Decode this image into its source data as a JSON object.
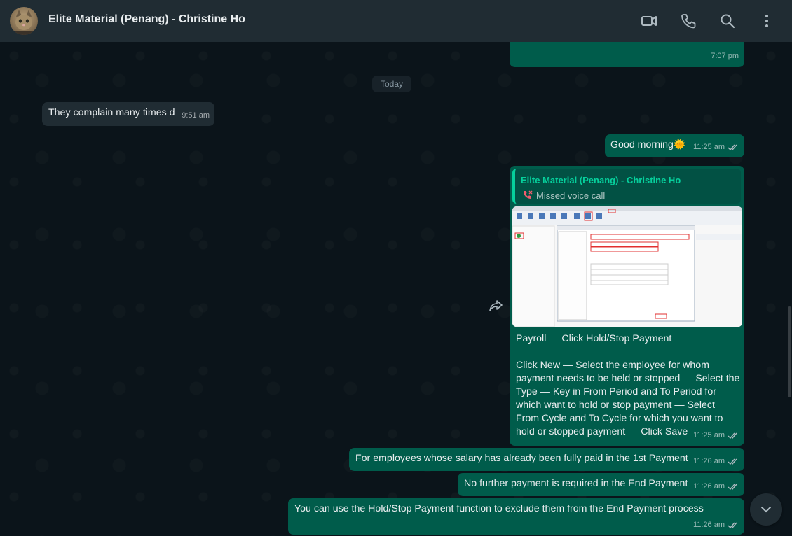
{
  "header": {
    "title": "Elite Material (Penang) - Christine Ho",
    "icons": [
      "video-call-icon",
      "voice-call-icon",
      "search-icon",
      "menu-icon"
    ]
  },
  "day_separator": "Today",
  "messages": {
    "prev_time": "7:07 pm",
    "m1": {
      "text": "They complain many times d",
      "time": "9:51 am"
    },
    "m2": {
      "text": "Good morning",
      "emoji": "🌞",
      "time": "11:25 am"
    },
    "m3": {
      "quote_name": "Elite Material (Penang) - Christine Ho",
      "quote_text": "Missed voice call",
      "line1": "Payroll — Click Hold/Stop Payment",
      "line2": "Click New — Select the employee for whom payment needs to be held or stopped — Select the Type — Key in From Period and To Period for which want to hold or stop payment — Select From Cycle and To Cycle for which you want to hold or stopped payment — Click Save",
      "time": "11:25 am"
    },
    "m4": {
      "text": "For employees whose salary has already been fully paid in the 1st Payment",
      "time": "11:26 am"
    },
    "m5": {
      "text": "No further payment is required in the End Payment",
      "time": "11:26 am"
    },
    "m6": {
      "text": "You can use the Hold/Stop Payment function to exclude them from the End Payment process",
      "time": "11:26 am"
    }
  },
  "colors": {
    "outgoing_bubble": "#005c4b",
    "incoming_bubble": "#202c33",
    "header": "#202c33",
    "accent": "#06cf9c",
    "missed_call": "#f15c6d"
  }
}
